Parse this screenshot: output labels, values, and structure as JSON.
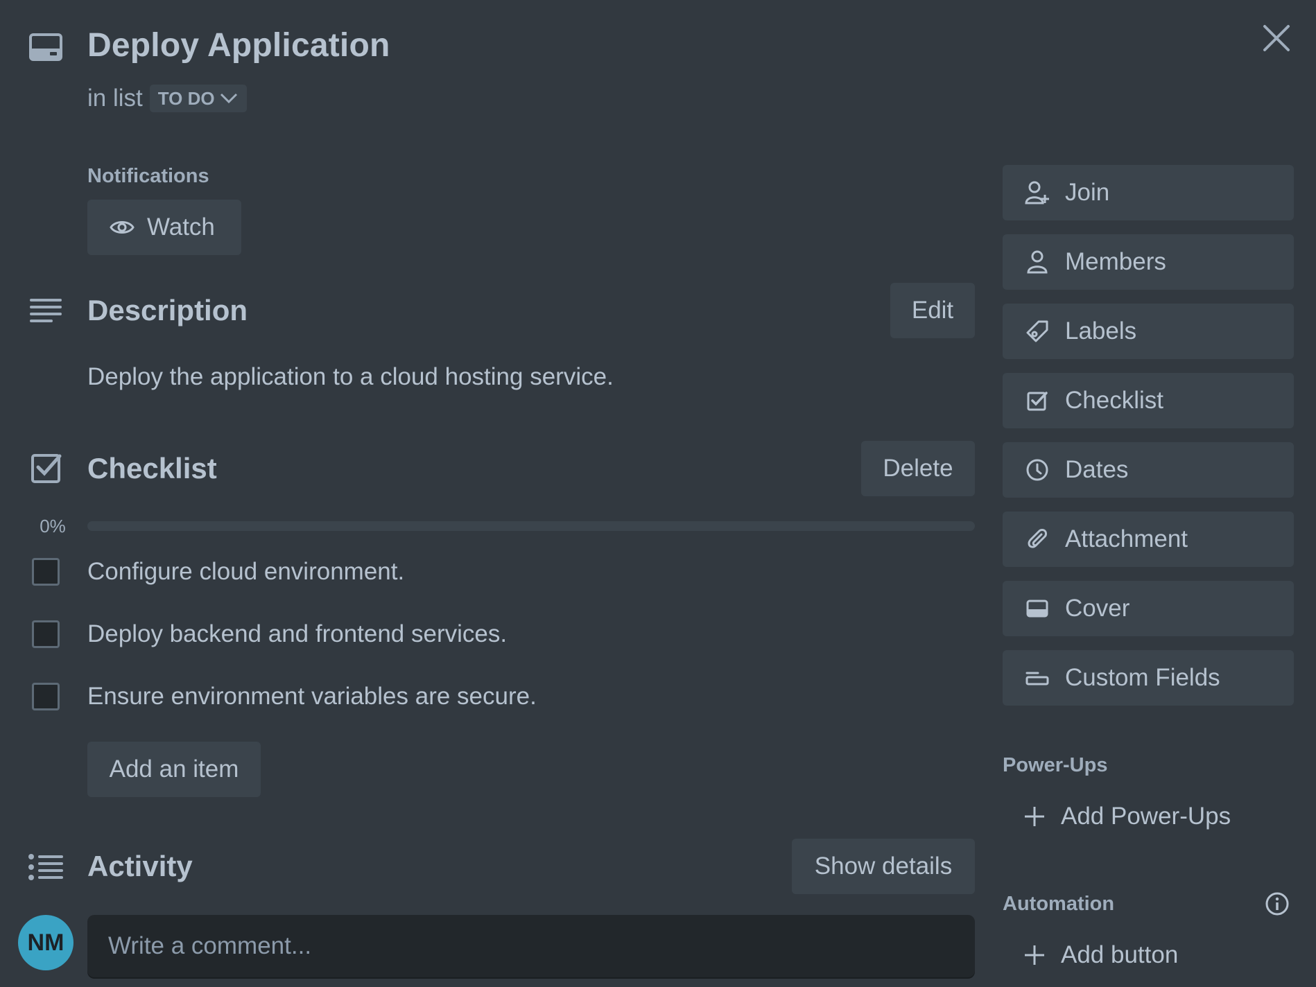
{
  "card": {
    "title": "Deploy Application",
    "in_list_prefix": "in list",
    "list_name": "TO DO"
  },
  "notifications": {
    "label": "Notifications",
    "watch_label": "Watch"
  },
  "description": {
    "title": "Description",
    "edit_label": "Edit",
    "text": "Deploy the application to a cloud hosting service."
  },
  "checklist": {
    "title": "Checklist",
    "delete_label": "Delete",
    "progress_percent": 0,
    "progress_label": "0%",
    "items": [
      {
        "text": "Configure cloud environment.",
        "checked": false
      },
      {
        "text": "Deploy backend and frontend services.",
        "checked": false
      },
      {
        "text": "Ensure environment variables are secure.",
        "checked": false
      }
    ],
    "add_item_label": "Add an item"
  },
  "activity": {
    "title": "Activity",
    "show_details_label": "Show details",
    "avatar_initials": "NM",
    "comment_placeholder": "Write a comment..."
  },
  "sidebar": {
    "actions": [
      {
        "label": "Join",
        "icon": "add-person-icon"
      },
      {
        "label": "Members",
        "icon": "person-icon"
      },
      {
        "label": "Labels",
        "icon": "tag-icon"
      },
      {
        "label": "Checklist",
        "icon": "checklist-icon"
      },
      {
        "label": "Dates",
        "icon": "clock-icon"
      },
      {
        "label": "Attachment",
        "icon": "paperclip-icon"
      },
      {
        "label": "Cover",
        "icon": "card-cover-icon"
      },
      {
        "label": "Custom Fields",
        "icon": "custom-field-icon"
      }
    ],
    "powerups_label": "Power-Ups",
    "add_powerups_label": "Add Power-Ups",
    "automation_label": "Automation",
    "add_button_label": "Add button"
  },
  "colors": {
    "background": "#323940",
    "button": "#3b444c",
    "text": "#b6c2cf",
    "subtle_text": "#9fadbc",
    "avatar": "#3aa3c4"
  }
}
